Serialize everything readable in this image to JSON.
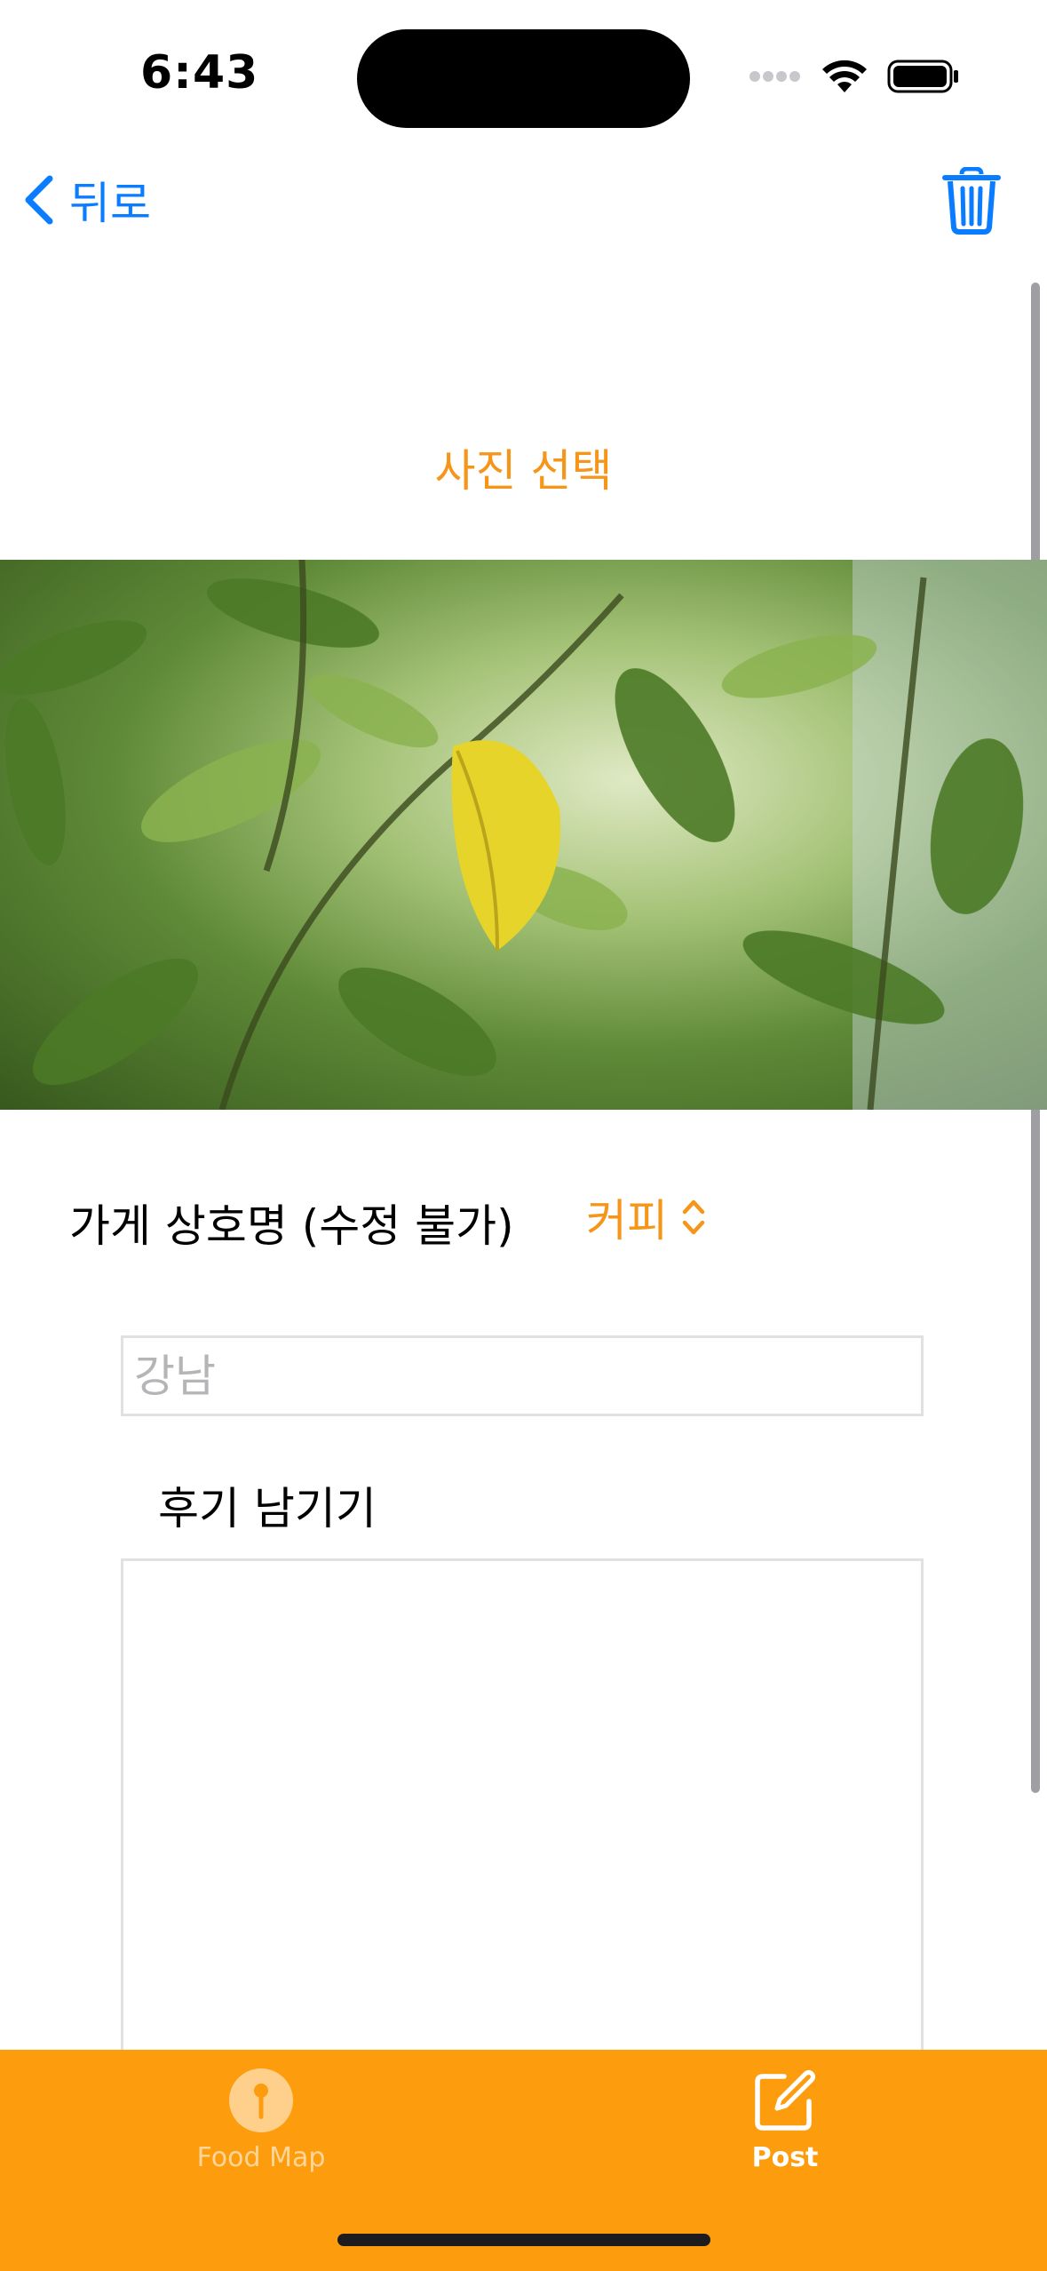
{
  "status_bar": {
    "time": "6:43"
  },
  "nav": {
    "back_label": "뒤로",
    "trash_icon": "trash-icon"
  },
  "photo_section": {
    "select_label": "사진 선택"
  },
  "store": {
    "name_label": "가게 상호명 (수정 불가)",
    "category_value": "커피"
  },
  "location": {
    "placeholder": "강남",
    "value": ""
  },
  "review": {
    "label": "후기 남기기",
    "value": ""
  },
  "tabbar": {
    "tabs": [
      {
        "label": "Food Map",
        "icon": "map-pin-icon",
        "selected": false
      },
      {
        "label": "Post",
        "icon": "compose-icon",
        "selected": true
      }
    ]
  },
  "colors": {
    "accent": "#f5961a",
    "tint": "#0a7cff",
    "tabbar": "#fd9d0d"
  }
}
